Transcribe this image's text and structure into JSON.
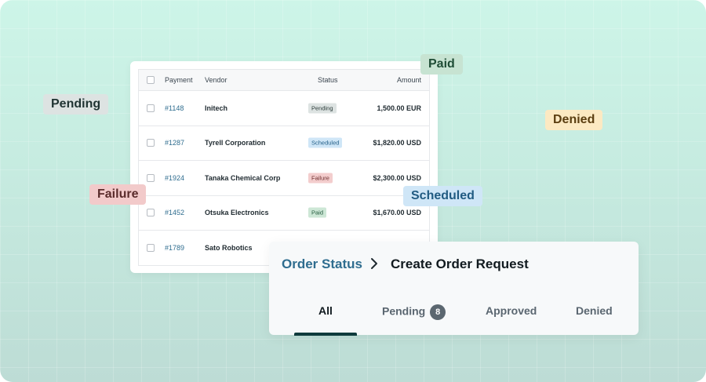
{
  "colors": {
    "link": "#2f6d8f",
    "pending_bg": "#dde3e2",
    "pending_fg": "#2a3a38",
    "scheduled_bg": "#cfe6f7",
    "scheduled_fg": "#27628a",
    "failure_bg": "#f3cdcd",
    "failure_fg": "#6e2f2f",
    "paid_bg": "#cde7d6",
    "paid_fg": "#235a3d",
    "denied_bg": "#fce9c2",
    "denied_fg": "#6b4a14"
  },
  "table": {
    "headers": {
      "payment": "Payment",
      "vendor": "Vendor",
      "status": "Status",
      "amount": "Amount"
    },
    "rows": [
      {
        "payment": "#1148",
        "vendor": "Initech",
        "status": "Pending",
        "amount": "1,500.00 EUR"
      },
      {
        "payment": "#1287",
        "vendor": "Tyrell Corporation",
        "status": "Scheduled",
        "amount": "$1,820.00 USD"
      },
      {
        "payment": "#1924",
        "vendor": "Tanaka Chemical Corp",
        "status": "Failure",
        "amount": "$2,300.00 USD"
      },
      {
        "payment": "#1452",
        "vendor": "Otsuka Electronics",
        "status": "Paid",
        "amount": "$1,670.00 USD"
      },
      {
        "payment": "#1789",
        "vendor": "Sato Robotics",
        "status": "",
        "amount": ""
      }
    ]
  },
  "floating_tags": {
    "pending": "Pending",
    "paid": "Paid",
    "denied": "Denied",
    "failure": "Failure",
    "scheduled": "Scheduled"
  },
  "order": {
    "breadcrumb_root": "Order Status",
    "breadcrumb_current": "Create Order Request",
    "separator_icon": "chevron-right-icon",
    "tabs": {
      "all": "All",
      "pending": "Pending",
      "pending_count": "8",
      "approved": "Approved",
      "denied": "Denied"
    }
  }
}
